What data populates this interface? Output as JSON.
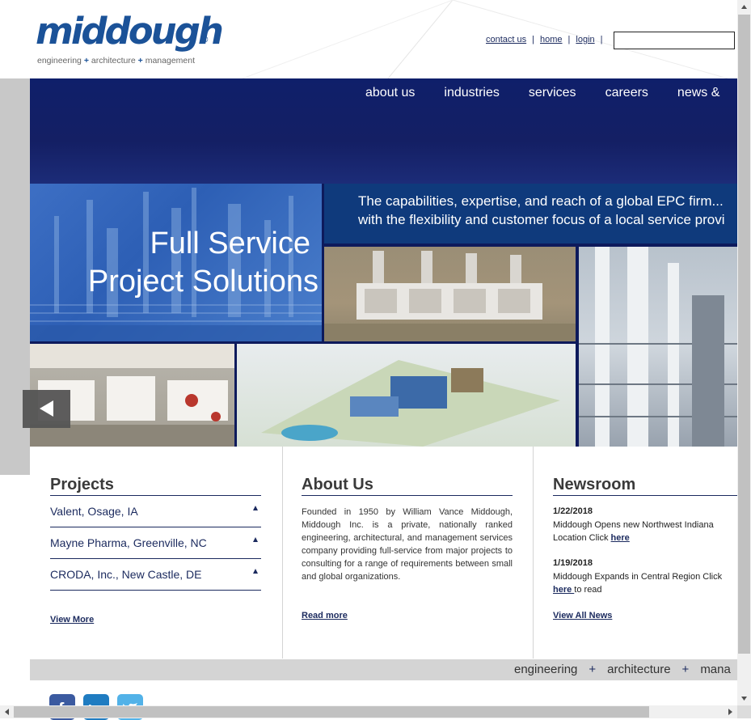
{
  "logo": {
    "wordmark": "middough",
    "registered": "®",
    "tagline_parts": [
      "engineering",
      "+",
      "architecture",
      "+",
      "management"
    ],
    "brand_color": "#1b5298"
  },
  "header": {
    "links": [
      "contact us",
      "home",
      "login"
    ],
    "separator": "|",
    "search_value": ""
  },
  "nav": {
    "items": [
      "about us",
      "industries",
      "services",
      "careers",
      "news &"
    ]
  },
  "hero": {
    "headline_line1": "Full Service",
    "headline_line2": "Project Solutions",
    "tagline_line1": "The capabilities, expertise, and reach of a global EPC firm...",
    "tagline_line2": "with the flexibility and customer focus of a local service provi",
    "prev_icon": "triangle-left-icon"
  },
  "projects": {
    "title": "Projects",
    "items": [
      "Valent, Osage, IA",
      "Mayne Pharma, Greenville, NC",
      "CRODA, Inc., New Castle, DE"
    ],
    "view_more": "View More"
  },
  "about": {
    "title": "About Us",
    "body": "Founded in 1950 by William Vance Middough, Middough Inc. is a private, nationally ranked engineering, architectural, and management services company providing full-service from major projects to consulting for a range of requirements between small and global organizations.",
    "read_more": "Read more"
  },
  "newsroom": {
    "title": "Newsroom",
    "items": [
      {
        "date": "1/22/2018",
        "text": "Middough Opens new Northwest Indiana Location Click ",
        "link": "here",
        "after": ""
      },
      {
        "date": "1/19/2018",
        "text": "Middough Expands in Central Region Click ",
        "link": "here ",
        "after": "to read"
      }
    ],
    "view_all": "View All News"
  },
  "footer": {
    "band_words": [
      "engineering",
      "+",
      "architecture",
      "+",
      "mana"
    ],
    "social_icons": [
      "facebook-icon",
      "linkedin-icon",
      "twitter-icon"
    ]
  },
  "colors": {
    "nav_band": "#141f64",
    "tagline_band": "#0f3a7c",
    "accent_navy": "#1b2a5e",
    "footer_band": "#d4d4d4"
  }
}
